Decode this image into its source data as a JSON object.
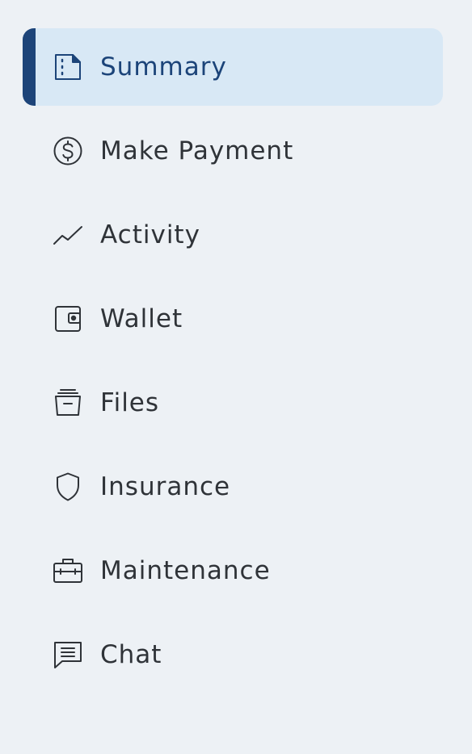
{
  "sidebar": {
    "active_color": "#1d4479",
    "active_background": "#d8e8f5",
    "items": [
      {
        "label": "Summary",
        "icon": "summary-document-icon",
        "active": true
      },
      {
        "label": "Make Payment",
        "icon": "dollar-circle-icon",
        "active": false
      },
      {
        "label": "Activity",
        "icon": "activity-line-icon",
        "active": false
      },
      {
        "label": "Wallet",
        "icon": "wallet-icon",
        "active": false
      },
      {
        "label": "Files",
        "icon": "files-box-icon",
        "active": false
      },
      {
        "label": "Insurance",
        "icon": "shield-icon",
        "active": false
      },
      {
        "label": "Maintenance",
        "icon": "toolbox-icon",
        "active": false
      },
      {
        "label": "Chat",
        "icon": "chat-message-icon",
        "active": false
      }
    ]
  }
}
